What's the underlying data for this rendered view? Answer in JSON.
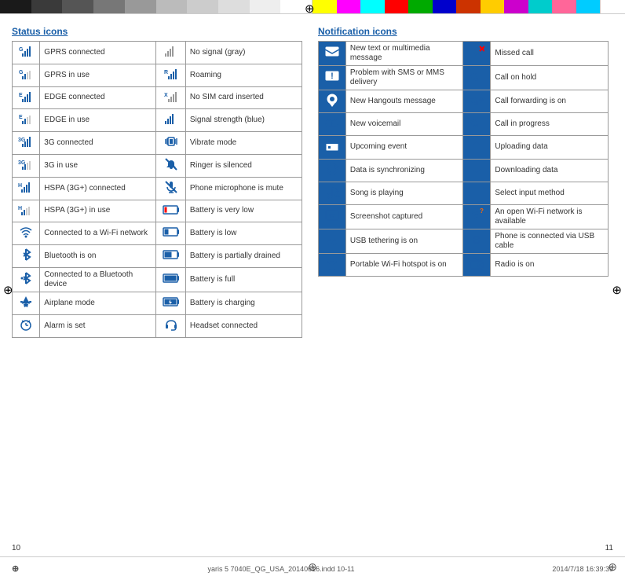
{
  "topBar": {
    "leftColors": [
      "#1a1a1a",
      "#3a3a3a",
      "#5a5a5a",
      "#7a7a7a",
      "#9a9a9a",
      "#bababa",
      "#dadada",
      "#f0f0f0",
      "#ffffff"
    ],
    "rightColors": [
      "#ffff00",
      "#ff00ff",
      "#00ffff",
      "#ff0000",
      "#00ff00",
      "#0000ff",
      "#ff6600",
      "#ffffff",
      "#000000",
      "#1a5fa8",
      "#ff0099",
      "#00ccff"
    ]
  },
  "sections": {
    "status": {
      "title": "Status icons",
      "rows": [
        {
          "icon": "G-signal",
          "label": "GPRS connected",
          "icon2": "no-signal",
          "label2": "No signal (gray)"
        },
        {
          "icon": "G-signal-use",
          "label": "GPRS in use",
          "icon2": "roaming",
          "label2": "Roaming"
        },
        {
          "icon": "E-signal",
          "label": "EDGE connected",
          "icon2": "no-sim",
          "label2": "No SIM card inserted"
        },
        {
          "icon": "E-signal-use",
          "label": "EDGE in use",
          "icon2": "signal-blue",
          "label2": "Signal strength (blue)"
        },
        {
          "icon": "3G-signal",
          "label": "3G connected",
          "icon2": "vibrate",
          "label2": "Vibrate mode"
        },
        {
          "icon": "3G-signal-use",
          "label": "3G in use",
          "icon2": "ringer-silenced",
          "label2": "Ringer is silenced"
        },
        {
          "icon": "H-signal",
          "label": "HSPA (3G+) connected",
          "icon2": "mic-mute",
          "label2": "Phone microphone is mute"
        },
        {
          "icon": "H-signal-use",
          "label": "HSPA (3G+) in use",
          "icon2": "battery-very-low",
          "label2": "Battery is very low"
        },
        {
          "icon": "wifi",
          "label": "Connected to a Wi-Fi network",
          "icon2": "battery-low",
          "label2": "Battery is low"
        },
        {
          "icon": "bluetooth",
          "label": "Bluetooth is on",
          "icon2": "battery-partial",
          "label2": "Battery is partially drained"
        },
        {
          "icon": "bluetooth-connected",
          "label": "Connected to a Bluetooth device",
          "icon2": "battery-full",
          "label2": "Battery is full"
        },
        {
          "icon": "airplane",
          "label": "Airplane mode",
          "icon2": "battery-charging",
          "label2": "Battery is charging"
        },
        {
          "icon": "alarm",
          "label": "Alarm is set",
          "icon2": "headset",
          "label2": "Headset connected"
        }
      ]
    },
    "notification": {
      "title": "Notification icons",
      "rows": [
        {
          "icon": "message",
          "label": "New text or multimedia message",
          "icon2": "missed-call",
          "label2": "Missed call"
        },
        {
          "icon": "sms-problem",
          "label": "Problem with SMS or MMS delivery",
          "icon2": "call-hold",
          "label2": "Call on hold"
        },
        {
          "icon": "hangouts",
          "label": "New Hangouts message",
          "icon2": "call-forwarding",
          "label2": "Call forwarding is on"
        },
        {
          "icon": "voicemail",
          "label": "New voicemail",
          "icon2": "call-progress",
          "label2": "Call in progress"
        },
        {
          "icon": "calendar",
          "label": "Upcoming event",
          "icon2": "upload",
          "label2": "Uploading data"
        },
        {
          "icon": "sync",
          "label": "Data is synchronizing",
          "icon2": "download",
          "label2": "Downloading data"
        },
        {
          "icon": "music",
          "label": "Song is playing",
          "icon2": "input-method",
          "label2": "Select input method"
        },
        {
          "icon": "screenshot",
          "label": "Screenshot captured",
          "icon2": "wifi-open",
          "label2": "An open Wi-Fi network is available"
        },
        {
          "icon": "usb-tethering",
          "label": "USB tethering is on",
          "icon2": "usb-cable",
          "label2": "Phone is connected via USB cable"
        },
        {
          "icon": "hotspot",
          "label": "Portable Wi-Fi hotspot is on",
          "icon2": "radio",
          "label2": "Radio is on"
        }
      ]
    }
  },
  "footer": {
    "filename": "yaris 5 7040E_QG_USA_20140616.indd  10-11",
    "date": "2014/7/18  16:39:39"
  },
  "pageNumbers": {
    "left": "10",
    "right": "11"
  }
}
